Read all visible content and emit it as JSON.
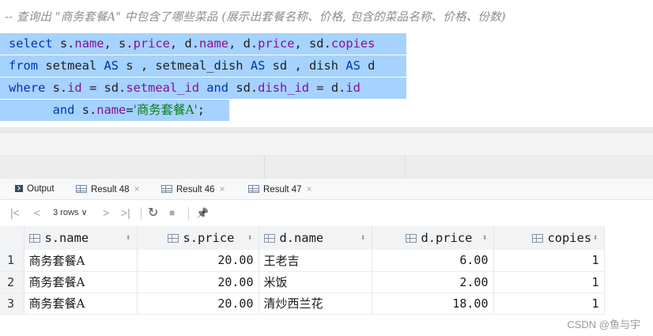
{
  "editor": {
    "comment": "-- 查询出 \"商务套餐A\" 中包含了哪些菜品 (展示出套餐名称、价格, 包含的菜品名称、价格、份数)",
    "line1": {
      "kw1": "select",
      "t1": " s.",
      "f1": "name",
      "t2": ", s.",
      "f2": "price",
      "t3": ", d.",
      "f3": "name",
      "t4": ", d.",
      "f4": "price",
      "t5": ", sd.",
      "f5": "copies"
    },
    "line2": {
      "kw1": "from",
      "t1": " setmeal ",
      "kw2": "AS",
      "t2": " s , setmeal_dish ",
      "kw3": "AS",
      "t3": " sd , dish ",
      "kw4": "AS",
      "t4": " d"
    },
    "line3": {
      "kw1": "where",
      "t1": " s.",
      "f1": "id",
      "t2": " = sd.",
      "f2": "setmeal_id",
      "t3": " ",
      "kw2": "and",
      "t4": " sd.",
      "f3": "dish_id",
      "t5": " = d.",
      "f4": "id"
    },
    "line4": {
      "indent": "      ",
      "kw1": "and",
      "t1": " s.",
      "f1": "name",
      "t2": "=",
      "s1": "'商务套餐A'",
      "t3": ";"
    }
  },
  "tabs": [
    {
      "label": "Output",
      "icon": "output-icon"
    },
    {
      "label": "Result 48",
      "icon": "grid-icon",
      "close": "×"
    },
    {
      "label": "Result 46",
      "icon": "grid-icon",
      "close": "×"
    },
    {
      "label": "Result 47",
      "icon": "grid-icon",
      "close": "×"
    }
  ],
  "toolbar": {
    "first": "|<",
    "prev": "<",
    "rows": "3 rows ∨",
    "next": ">",
    "last": ">|",
    "refresh": "↻",
    "stop": "■",
    "pin": "📌"
  },
  "table": {
    "columns": [
      {
        "label": "s.name",
        "sort": "⬍"
      },
      {
        "label": "s.price",
        "sort": "⬍"
      },
      {
        "label": "d.name",
        "sort": "⬍"
      },
      {
        "label": "d.price",
        "sort": "⬍"
      },
      {
        "label": "copies",
        "sort": "⬍"
      }
    ],
    "rows": [
      {
        "n": "1",
        "s_name": "商务套餐A",
        "s_price": "20.00",
        "d_name": "王老吉",
        "d_price": "6.00",
        "copies": "1"
      },
      {
        "n": "2",
        "s_name": "商务套餐A",
        "s_price": "20.00",
        "d_name": "米饭",
        "d_price": "2.00",
        "copies": "1"
      },
      {
        "n": "3",
        "s_name": "商务套餐A",
        "s_price": "20.00",
        "d_name": "清炒西兰花",
        "d_price": "18.00",
        "copies": "1"
      }
    ]
  },
  "watermark": "CSDN @鱼与宇",
  "colors": {
    "selection": "#a6d2ff",
    "keyword": "#0033b3",
    "field": "#871094",
    "string": "#067d17"
  }
}
